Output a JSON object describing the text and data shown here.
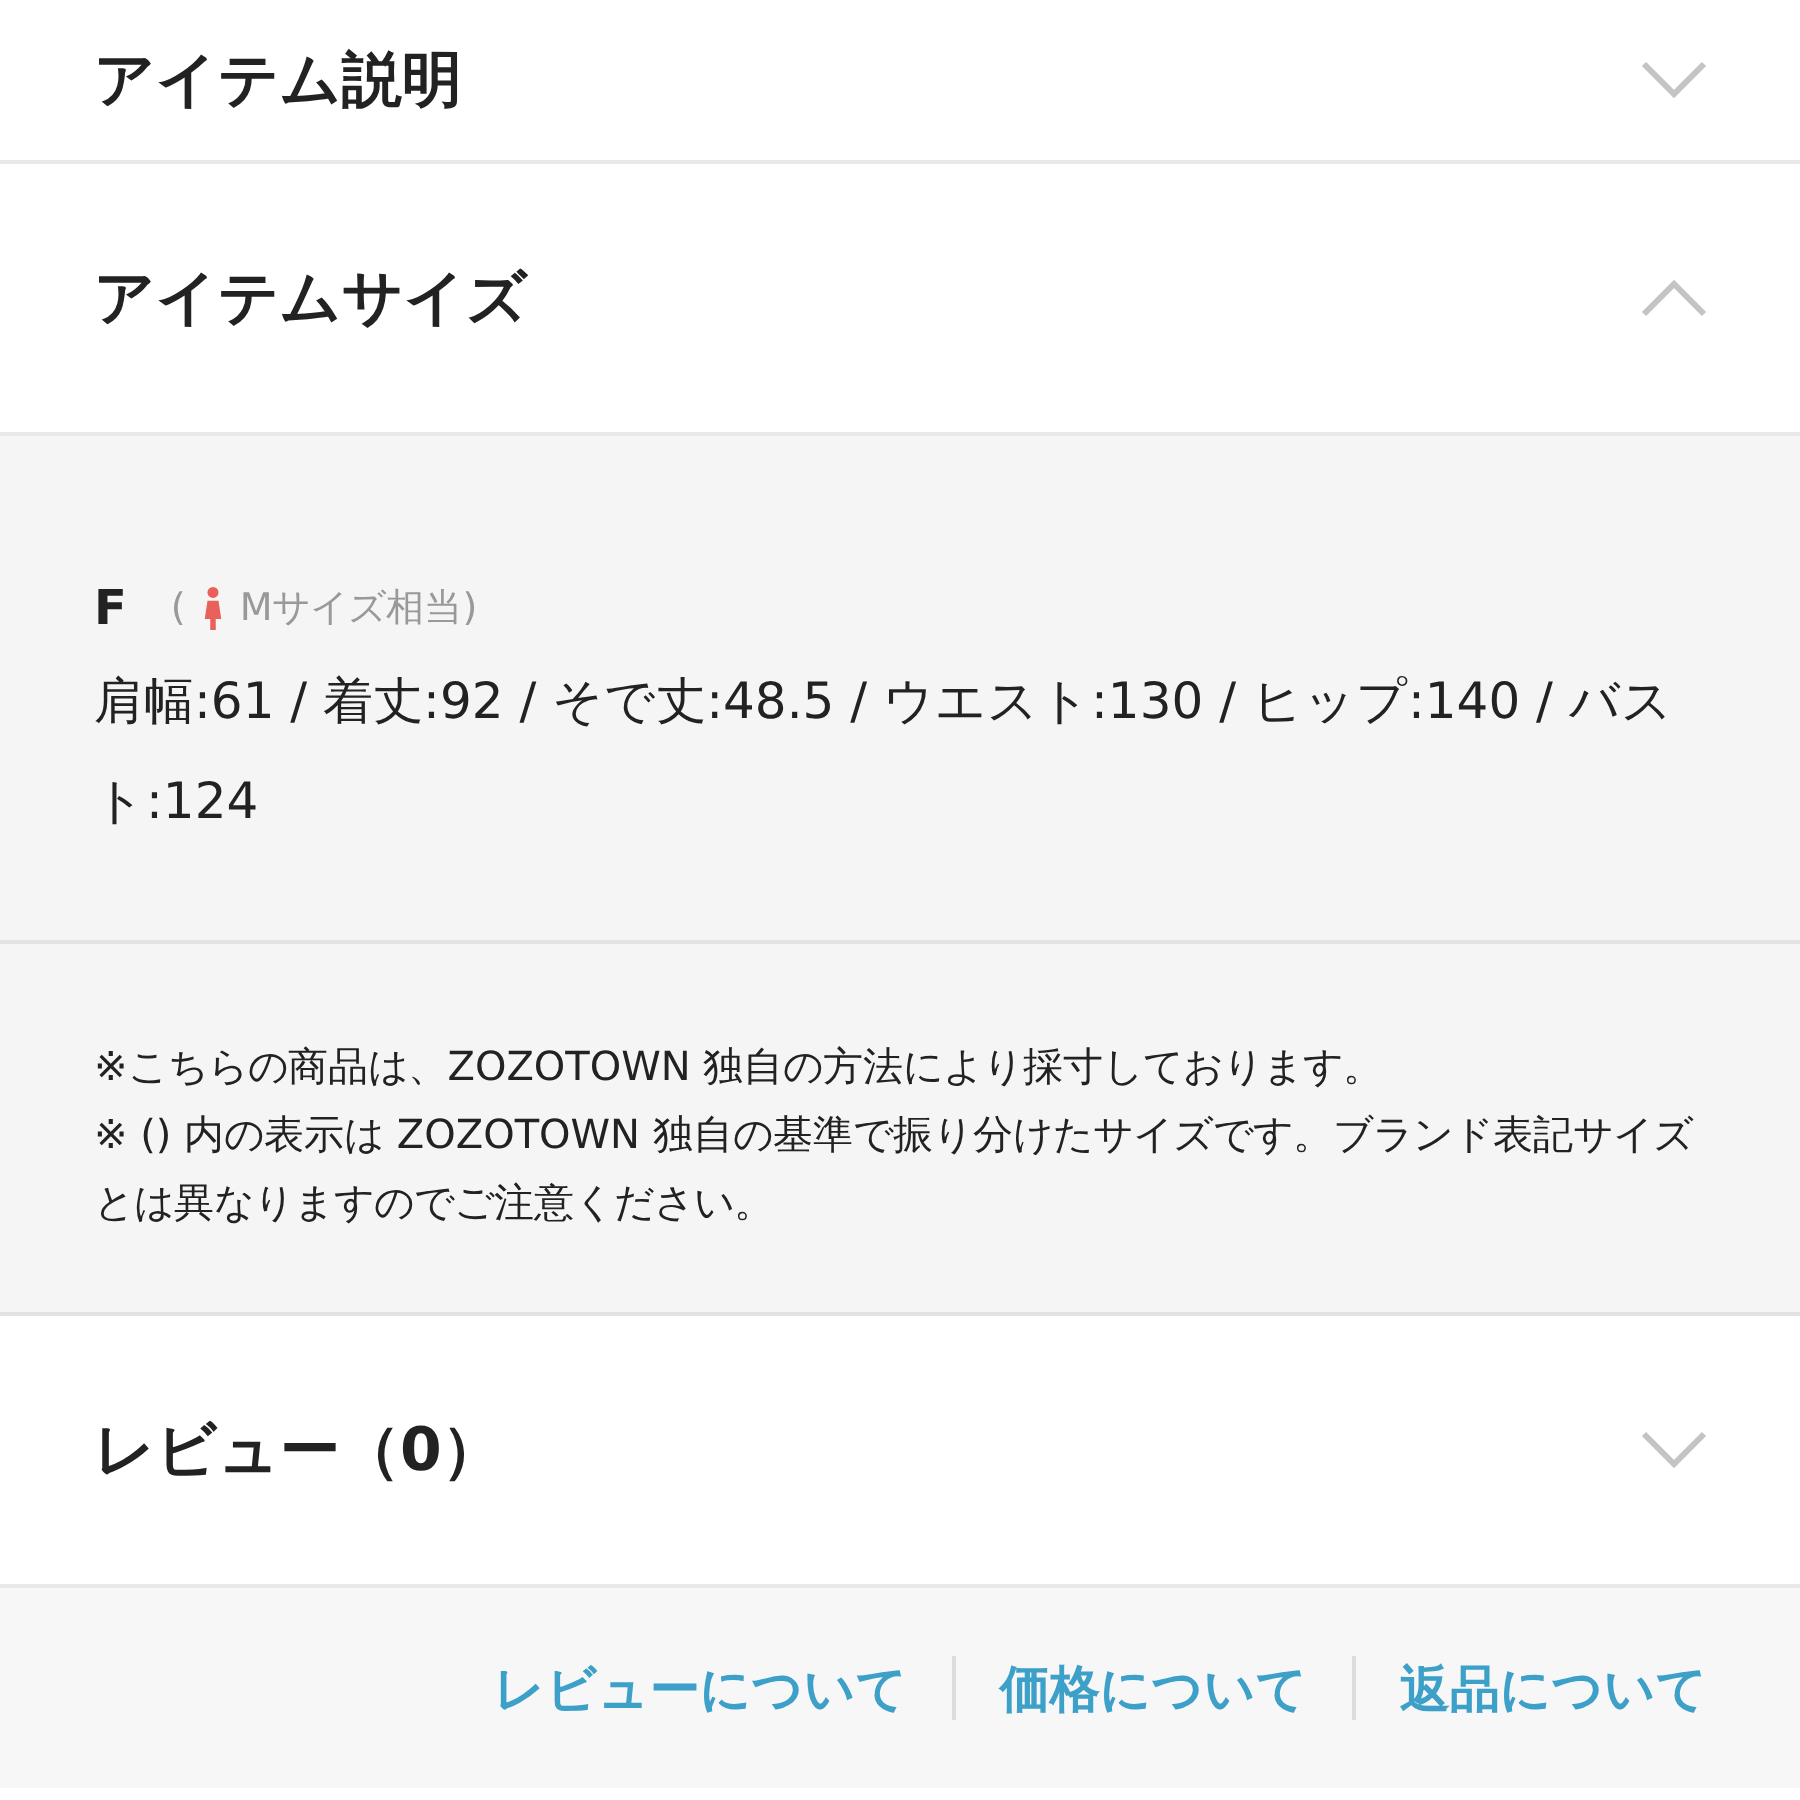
{
  "sections": [
    {
      "title": "アイテム説明",
      "expanded": false
    },
    {
      "title": "アイテムサイズ",
      "expanded": true,
      "size": {
        "label": "F",
        "open_paren": "(",
        "equivalent": "Mサイズ相当)",
        "measurements": "肩幅:61 / 着丈:92 / そで丈:48.5 / ウエスト:130 / ヒップ:140 / バスト:124"
      },
      "notes": [
        "※こちらの商品は、ZOZOTOWN 独自の方法により採寸しております。",
        "※ () 内の表示は ZOZOTOWN 独自の基準で振り分けたサイズです。ブランド表記サイズとは異なりますのでご注意ください。"
      ]
    },
    {
      "title": "レビュー（0）",
      "expanded": false
    }
  ],
  "footer_links": [
    "レビューについて",
    "価格について",
    "返品について"
  ]
}
